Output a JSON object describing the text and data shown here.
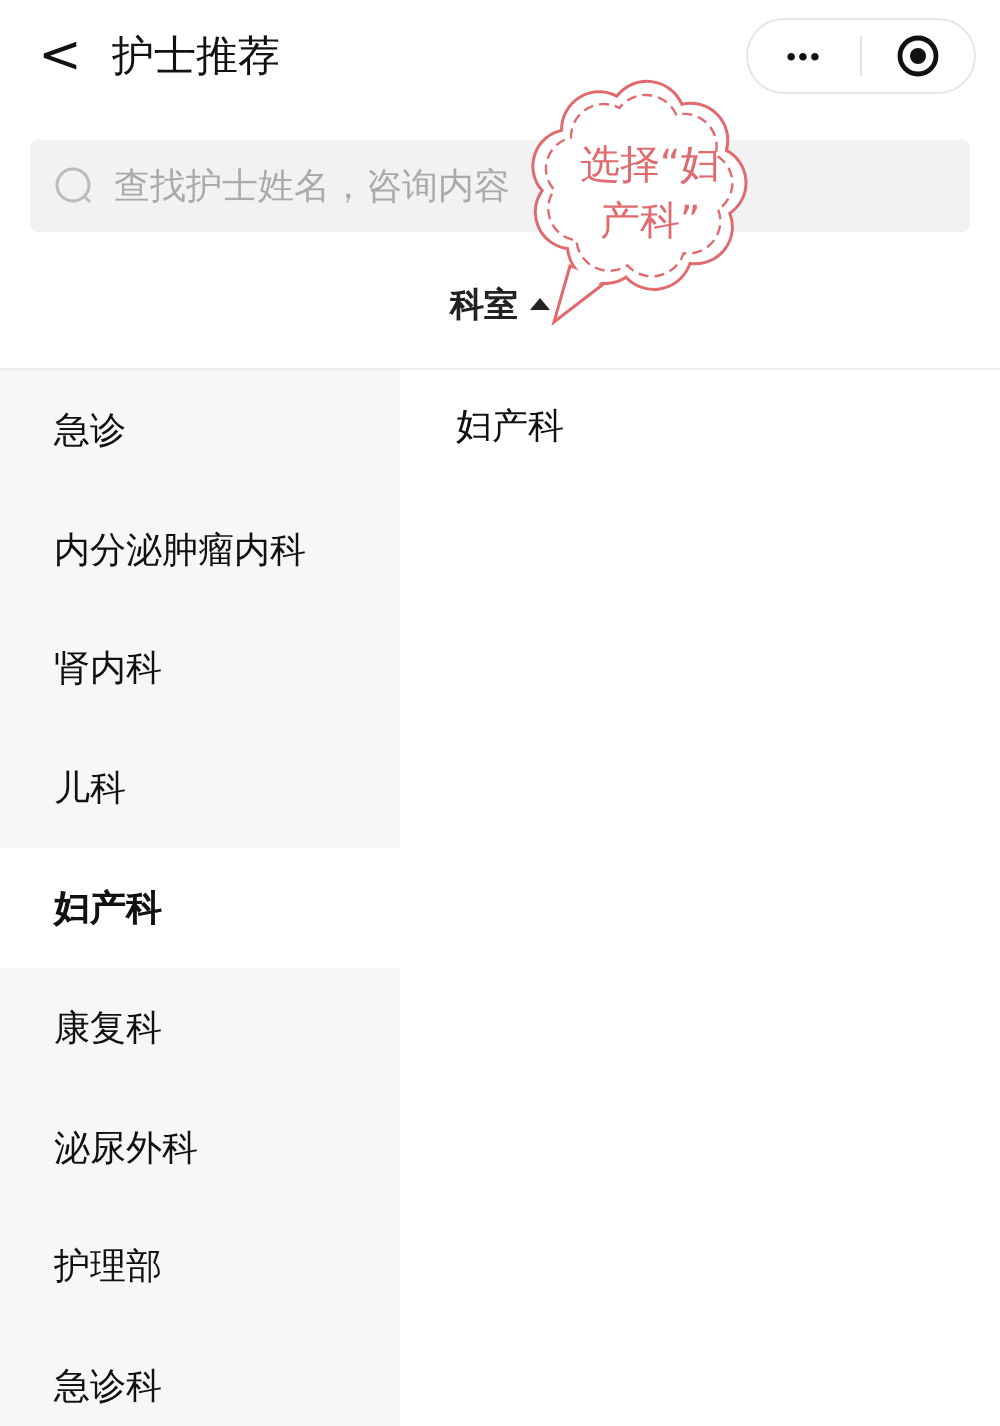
{
  "header": {
    "back": "<",
    "title": "护士推荐"
  },
  "capsule": {
    "more": "•••"
  },
  "search": {
    "placeholder": "查找护士姓名，咨询内容"
  },
  "filter": {
    "label": "科室",
    "expanded": true
  },
  "callout": {
    "text": "选择“妇产科”"
  },
  "departments": [
    {
      "label": "急诊",
      "selected": false
    },
    {
      "label": "内分泌肿瘤内科",
      "selected": false
    },
    {
      "label": "肾内科",
      "selected": false
    },
    {
      "label": "儿科",
      "selected": false
    },
    {
      "label": "妇产科",
      "selected": true
    },
    {
      "label": "康复科",
      "selected": false
    },
    {
      "label": "泌尿外科",
      "selected": false
    },
    {
      "label": "护理部",
      "selected": false
    },
    {
      "label": "急诊科",
      "selected": false
    }
  ],
  "sub_items": [
    {
      "label": "妇产科"
    }
  ]
}
